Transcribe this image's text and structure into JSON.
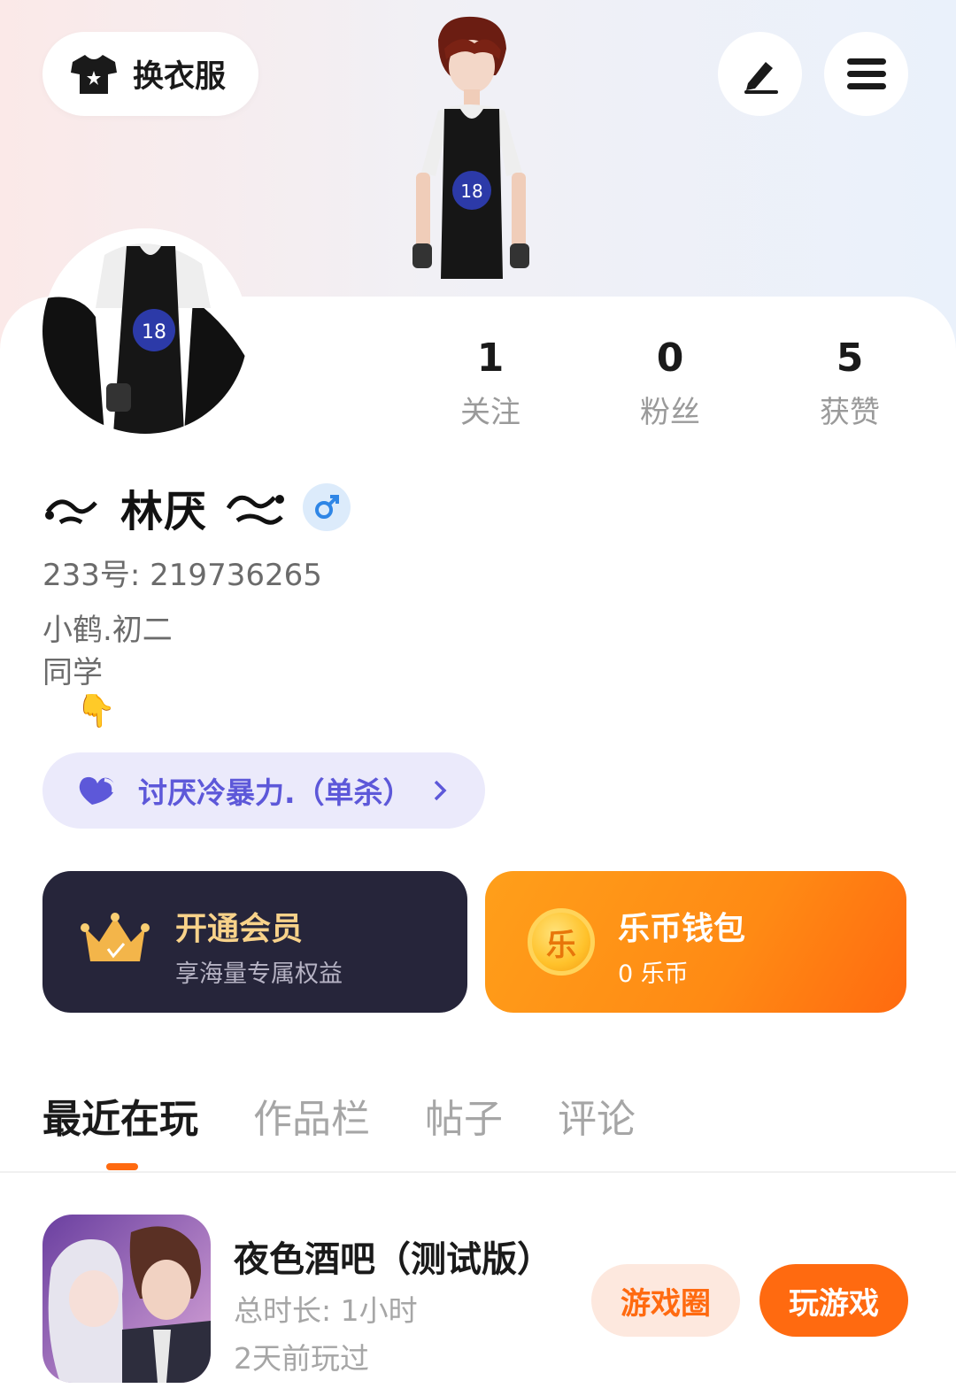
{
  "header": {
    "outfit_button_label": "换衣服",
    "outfit_icon": "tshirt-icon",
    "edit_icon": "pencil-icon",
    "menu_icon": "hamburger-menu-icon"
  },
  "stats": [
    {
      "value": "1",
      "label": "关注"
    },
    {
      "value": "0",
      "label": "粉丝"
    },
    {
      "value": "5",
      "label": "获赞"
    }
  ],
  "profile": {
    "name": "林厌",
    "gender_icon": "male-icon",
    "uid_label": "233号:",
    "uid": "219736265",
    "bio_line1": "小鹤.初二",
    "bio_line2": "同学",
    "bio_emoji": "👇"
  },
  "tag": {
    "icon": "heart-icon",
    "label": "讨厌冷暴力.（单杀）",
    "chevron_icon": "chevron-right-icon"
  },
  "vip": {
    "icon": "crown-icon",
    "title": "开通会员",
    "subtitle": "享海量专属权益"
  },
  "wallet": {
    "icon": "coin-icon",
    "coin_glyph": "乐",
    "title": "乐币钱包",
    "subtitle": "0 乐币"
  },
  "tabs": [
    {
      "label": "最近在玩",
      "active": true
    },
    {
      "label": "作品栏",
      "active": false
    },
    {
      "label": "帖子",
      "active": false
    },
    {
      "label": "评论",
      "active": false
    }
  ],
  "recent_game": {
    "title": "夜色酒吧（测试版）",
    "duration": "总时长:  1小时",
    "last_played": "2天前玩过",
    "circle_button": "游戏圈",
    "play_button": "玩游戏"
  },
  "colors": {
    "accent": "#ff6a10",
    "vip_bg": "#26253a",
    "tag_bg": "#ebeafb",
    "tag_text": "#5d58d9"
  }
}
